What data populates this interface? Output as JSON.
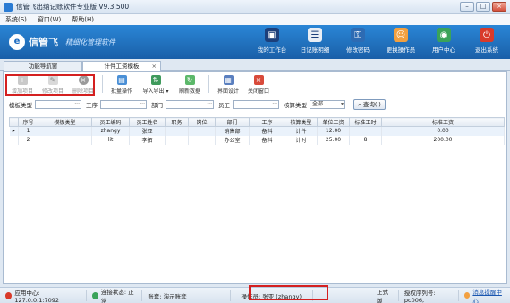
{
  "window": {
    "title": "信管飞出纳记账软件专业版 V9.3.500",
    "buttons": [
      "–",
      "□",
      "×"
    ]
  },
  "menu": [
    "系统(S)",
    "窗口(W)",
    "帮助(H)"
  ],
  "banner": {
    "logo_mark": "e",
    "logo_text": "信管飞",
    "logo_sub": "精细化管理软件",
    "buttons": [
      {
        "label": "我的工作台",
        "icon": "desktop-icon",
        "color": "#1c3f7a",
        "glyph": "▣"
      },
      {
        "label": "日记账明细",
        "icon": "list-icon",
        "color": "#e9eef5",
        "glyph": "☰"
      },
      {
        "label": "修改密码",
        "icon": "key-icon",
        "color": "#2d6bb3",
        "glyph": "⚿"
      },
      {
        "label": "更换操作员",
        "icon": "user-icon",
        "color": "#f2a040",
        "glyph": "☺"
      },
      {
        "label": "用户中心",
        "icon": "globe-icon",
        "color": "#3aa35a",
        "glyph": "◉"
      },
      {
        "label": "退出系统",
        "icon": "power-icon",
        "color": "#d83a2a",
        "glyph": "⏻"
      }
    ]
  },
  "tabs": {
    "nav": "功能导航窗",
    "active": "计件工资模板",
    "close": "×"
  },
  "toolbar": {
    "add": "增加项目",
    "edit": "修改项目",
    "delete": "删除项目",
    "batch": "批量操作",
    "import_export": "导入导出",
    "refresh": "刷新数据",
    "ui_design": "界面设计",
    "close_window": "关闭窗口"
  },
  "filters": {
    "template_type_label": "模板类型",
    "process_label": "工序",
    "dept_label": "部门",
    "employee_label": "员工",
    "calc_type_label": "核算类型",
    "calc_type_value": "全部",
    "dots": "···",
    "dropdown": "▾",
    "search_label": "查询(I)",
    "search_glyph": "⌕"
  },
  "table": {
    "headers": [
      "序号",
      "模板类型",
      "员工编码",
      "员工姓名",
      "职务",
      "岗位",
      "部门",
      "工序",
      "核算类型",
      "单位工资",
      "标准工时",
      "标准工资"
    ],
    "rows": [
      {
        "marker": "▸",
        "no": "1",
        "type": "",
        "code": "zhangy",
        "name": "张亚",
        "title": "",
        "post": "",
        "dept": "销售部",
        "process": "备料",
        "calc": "计件",
        "unit_wage": "12.00",
        "std_hours": "",
        "std_wage": "0.00"
      },
      {
        "marker": "",
        "no": "2",
        "type": "",
        "code": "lit",
        "name": "李拓",
        "title": "",
        "post": "",
        "dept": "办公室",
        "process": "备料",
        "calc": "计时",
        "unit_wage": "25.00",
        "std_hours": "8",
        "std_wage": "200.00"
      }
    ]
  },
  "status": {
    "app_center": "应用中心: 127.0.0.1:7092",
    "connection": "连接状态: 正常",
    "ledger": "账套: 演示账套",
    "operator": "操作员: 张亚 (zhangy)",
    "edition": "正式版",
    "license": "授权序列号: pc006,",
    "message": "消息提醒中心"
  }
}
